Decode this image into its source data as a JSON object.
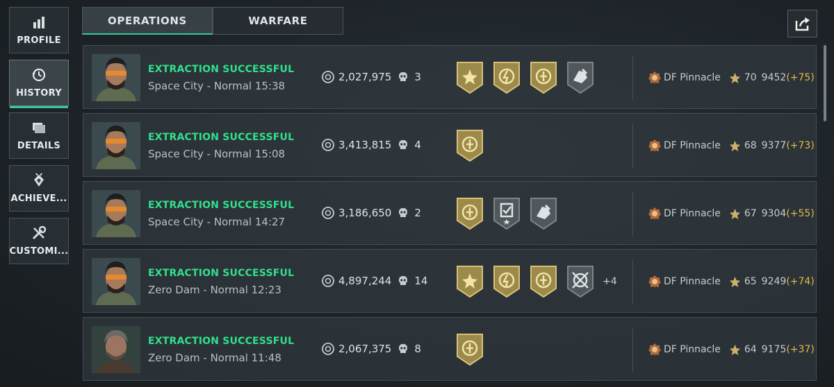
{
  "sidebar": {
    "items": [
      {
        "label": "PROFILE",
        "icon": "bar-chart-icon",
        "active": false
      },
      {
        "label": "HISTORY",
        "icon": "history-clock-icon",
        "active": true
      },
      {
        "label": "DETAILS",
        "icon": "folder-icon",
        "active": false
      },
      {
        "label": "ACHIEVE...",
        "icon": "achievement-icon",
        "active": false
      },
      {
        "label": "CUSTOMI...",
        "icon": "tools-icon",
        "active": false
      }
    ]
  },
  "tabs": [
    {
      "label": "OPERATIONS",
      "active": true
    },
    {
      "label": "WARFARE",
      "active": false
    }
  ],
  "colors": {
    "accent": "#35c9a0",
    "success": "#31e08c",
    "gain": "#e0b84a"
  },
  "matches": [
    {
      "status": "EXTRACTION SUCCESSFUL",
      "map": "Space City - Normal 15:38",
      "value": "2,027,975",
      "kills": "3",
      "badges": [
        "gold-star",
        "gold-bolt",
        "gold-coin",
        "gray-hand"
      ],
      "more": "",
      "rank": "DF Pinnacle",
      "level": "70",
      "score": "9452",
      "gain": "(+75)",
      "avatar": "soldier-a"
    },
    {
      "status": "EXTRACTION SUCCESSFUL",
      "map": "Space City - Normal 15:08",
      "value": "3,413,815",
      "kills": "4",
      "badges": [
        "gold-coin"
      ],
      "more": "",
      "rank": "DF Pinnacle",
      "level": "68",
      "score": "9377",
      "gain": "(+73)",
      "avatar": "soldier-a"
    },
    {
      "status": "EXTRACTION SUCCESSFUL",
      "map": "Space City - Normal 14:27",
      "value": "3,186,650",
      "kills": "2",
      "badges": [
        "gold-coin",
        "gray-check",
        "gray-hand"
      ],
      "more": "",
      "rank": "DF Pinnacle",
      "level": "67",
      "score": "9304",
      "gain": "(+55)",
      "avatar": "soldier-a"
    },
    {
      "status": "EXTRACTION SUCCESSFUL",
      "map": "Zero Dam - Normal 12:23",
      "value": "4,897,244",
      "kills": "14",
      "badges": [
        "gold-star",
        "gold-bolt",
        "gold-coin",
        "gray-target"
      ],
      "more": "+4",
      "rank": "DF Pinnacle",
      "level": "65",
      "score": "9249",
      "gain": "(+74)",
      "avatar": "soldier-a"
    },
    {
      "status": "EXTRACTION SUCCESSFUL",
      "map": "Zero Dam - Normal 11:48",
      "value": "2,067,375",
      "kills": "8",
      "badges": [
        "gold-coin"
      ],
      "more": "",
      "rank": "DF Pinnacle",
      "level": "64",
      "score": "9175",
      "gain": "(+37)",
      "avatar": "soldier-b"
    }
  ]
}
